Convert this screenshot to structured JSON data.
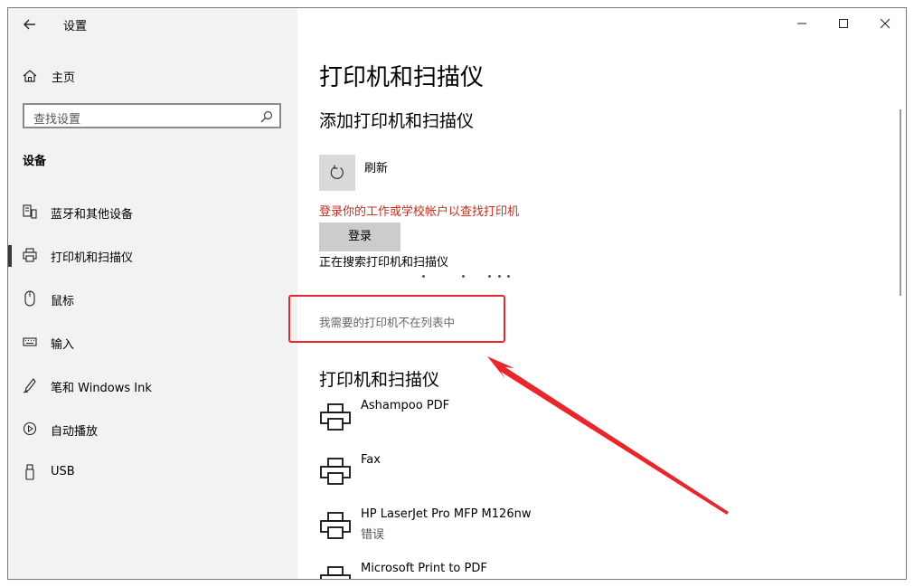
{
  "window": {
    "title": "设置"
  },
  "sidebar": {
    "home_label": "主页",
    "search_placeholder": "查找设置",
    "section_title": "设备",
    "items": [
      {
        "label": "蓝牙和其他设备",
        "icon": "bluetooth-devices-icon"
      },
      {
        "label": "打印机和扫描仪",
        "icon": "printer-icon",
        "selected": true
      },
      {
        "label": "鼠标",
        "icon": "mouse-icon"
      },
      {
        "label": "输入",
        "icon": "keyboard-icon"
      },
      {
        "label": "笔和 Windows Ink",
        "icon": "pen-icon"
      },
      {
        "label": "自动播放",
        "icon": "autoplay-icon"
      },
      {
        "label": "USB",
        "icon": "usb-icon"
      }
    ]
  },
  "main": {
    "page_title": "打印机和扫描仪",
    "add_section_title": "添加打印机和扫描仪",
    "refresh_label": "刷新",
    "signin_warning": "登录你的工作或学校帐户以查找打印机",
    "signin_button": "登录",
    "searching_text": "正在搜索打印机和扫描仪",
    "not_listed_link": "我需要的打印机不在列表中",
    "printers_section_title": "打印机和扫描仪",
    "printers": [
      {
        "name": "Ashampoo PDF",
        "status": ""
      },
      {
        "name": "Fax",
        "status": ""
      },
      {
        "name": "HP LaserJet Pro MFP M126nw",
        "status": "错误"
      },
      {
        "name": "Microsoft Print to PDF",
        "status": ""
      }
    ]
  },
  "colors": {
    "warning": "#c42b1c",
    "annotation": "#e8262b",
    "sidebar_bg": "#f2f2f2",
    "button_bg": "#cccccc"
  }
}
